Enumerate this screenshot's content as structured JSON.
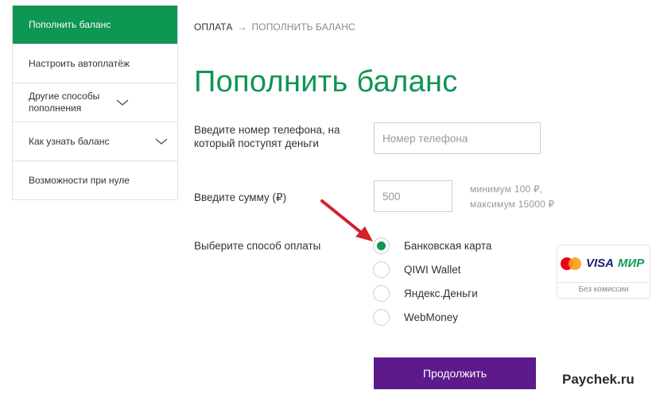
{
  "sidebar": {
    "items": [
      {
        "label": "Пополнить баланс",
        "active": true
      },
      {
        "label": "Настроить автоплатёж"
      },
      {
        "label": "Другие способы пополнения",
        "has_chevron": true
      },
      {
        "label": "Как узнать баланс",
        "has_chevron": true
      },
      {
        "label": "Возможности при нуле"
      }
    ]
  },
  "breadcrumb": {
    "root": "ОПЛАТА",
    "separator": "→",
    "current": "ПОПОЛНИТЬ БАЛАНС"
  },
  "page_title": "Пополнить баланс",
  "phone": {
    "label_line1": "Введите номер телефона, на",
    "label_line2": "который поступят деньги",
    "placeholder": "Номер телефона"
  },
  "amount": {
    "label": "Введите сумму (₽)",
    "placeholder": "500",
    "hint_min": "минимум 100 ₽,",
    "hint_max": "максимум 15000 ₽"
  },
  "payment": {
    "label": "Выберите способ оплаты",
    "options": [
      {
        "label": "Банковская карта",
        "selected": true
      },
      {
        "label": "QIWI Wallet"
      },
      {
        "label": "Яндекс.Деньги"
      },
      {
        "label": "WebMoney"
      }
    ]
  },
  "card_badge": {
    "visa": "VISA",
    "mir": "МИР",
    "caption": "Без комиссии",
    "mastercard_text": "mastercard"
  },
  "submit_label": "Продолжить",
  "watermark": "Paychek.ru",
  "colors": {
    "accent_green": "#0e9653",
    "button_purple": "#5c1a8c",
    "arrow_red": "#d3212a"
  }
}
